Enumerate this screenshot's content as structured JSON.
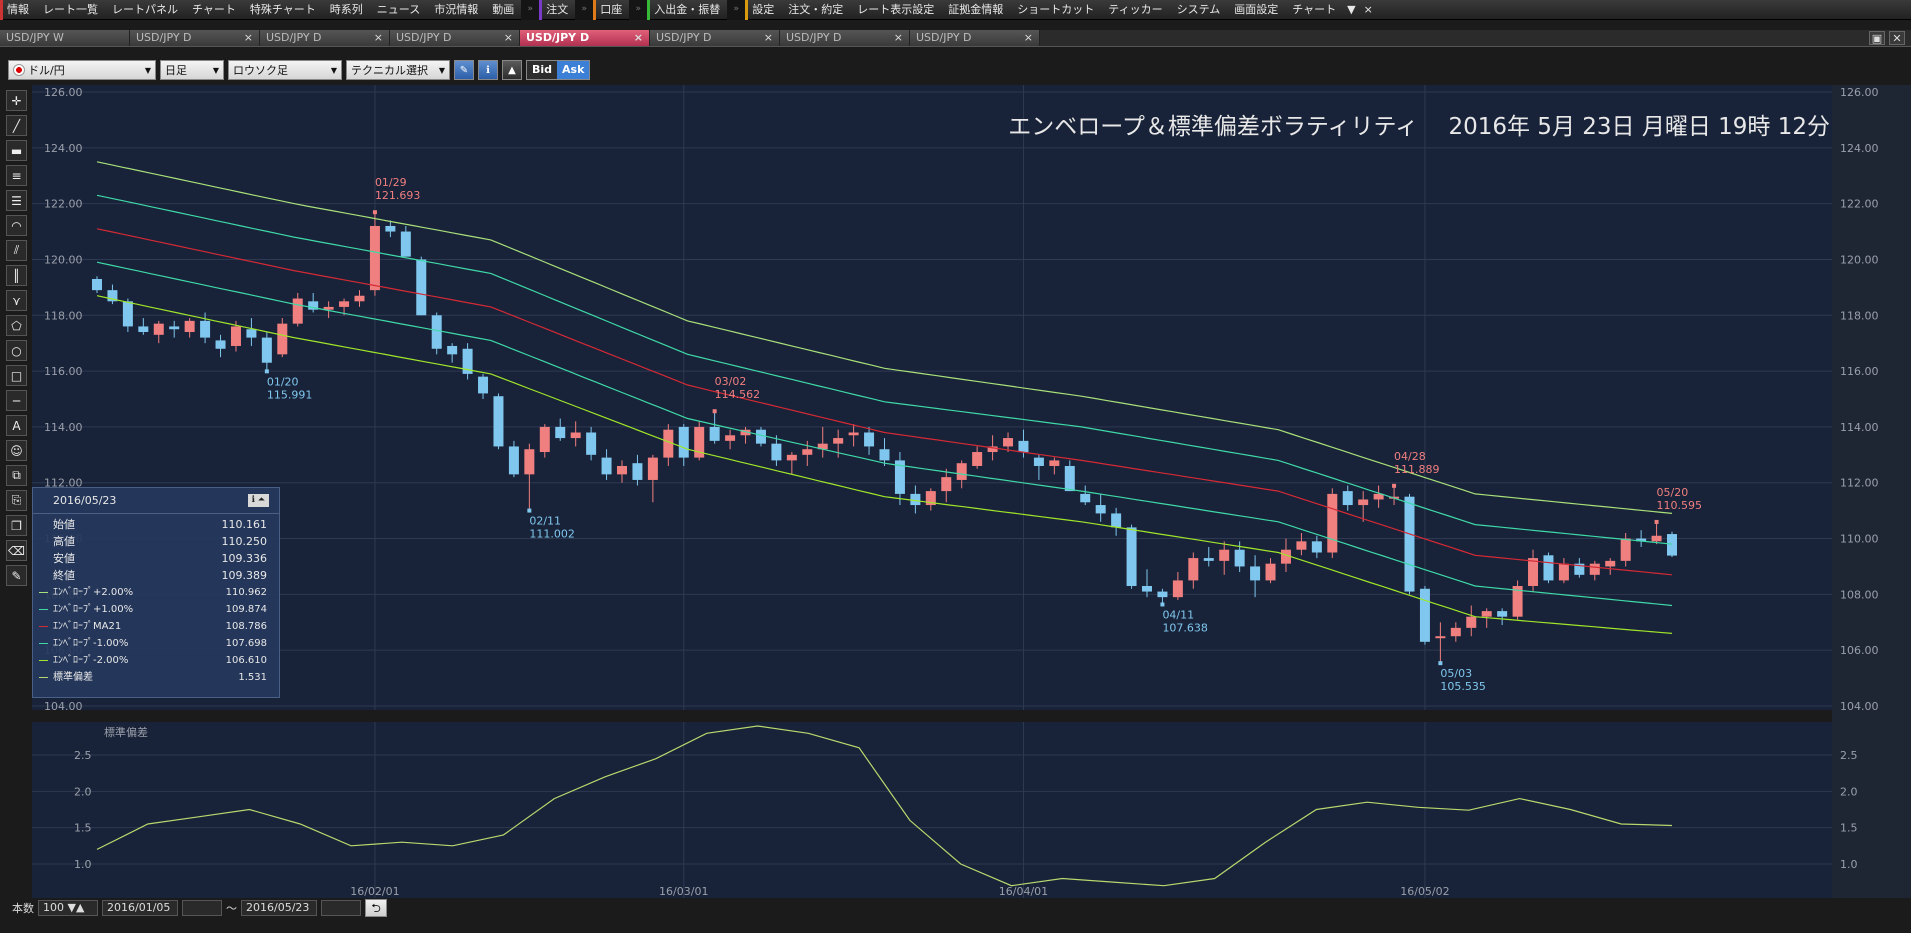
{
  "menu": {
    "items": [
      {
        "label": "情報",
        "mark": "r"
      },
      {
        "label": "レート一覧"
      },
      {
        "label": "レートパネル"
      },
      {
        "label": "チャート"
      },
      {
        "label": "特殊チャート"
      },
      {
        "label": "時系列"
      },
      {
        "label": "ニュース"
      },
      {
        "label": "市況情報"
      },
      {
        "label": "動画"
      },
      {
        "label": "注文",
        "mark": "p"
      },
      {
        "label": "口座",
        "mark": "o"
      },
      {
        "label": "入出金・振替",
        "mark": "g"
      },
      {
        "label": "設定",
        "mark": "y"
      },
      {
        "label": "注文・約定"
      },
      {
        "label": "レート表示設定"
      },
      {
        "label": "証拠金情報"
      },
      {
        "label": "ショートカット"
      },
      {
        "label": "ティッカー"
      },
      {
        "label": "システム"
      },
      {
        "label": "画面設定"
      },
      {
        "label": "チャート"
      }
    ],
    "overflow_glyph": "»",
    "dropdown_glyph": "▼",
    "close_glyph": "×"
  },
  "tabs": [
    {
      "label": "USD/JPY W",
      "active": false
    },
    {
      "label": "USD/JPY D",
      "active": false
    },
    {
      "label": "USD/JPY D",
      "active": false
    },
    {
      "label": "USD/JPY D",
      "active": false
    },
    {
      "label": "USD/JPY D",
      "active": true
    },
    {
      "label": "USD/JPY D",
      "active": false
    },
    {
      "label": "USD/JPY D",
      "active": false
    },
    {
      "label": "USD/JPY D",
      "active": false
    }
  ],
  "tab_close_glyph": "×",
  "window_buttons": [
    "▣",
    "✕"
  ],
  "toolbar": {
    "symbol": "ドル/円",
    "interval": "日足",
    "chart_kind": "ロウソク足",
    "technical": "テクニカル選択",
    "bid": "Bid",
    "ask": "Ask",
    "pen_icon": "pencil-icon",
    "info_icon": "info-icon",
    "area_icon": "area-chart-icon"
  },
  "left_tools": [
    "crosshair-icon",
    "trendline-icon",
    "eraser-icon",
    "hline-icon",
    "channel-icon",
    "fibonacci-arc-icon",
    "fan-icon",
    "vline-icon",
    "pitchfork-icon",
    "pentagon-icon",
    "circle-icon",
    "rectangle-icon",
    "line-icon",
    "text-icon",
    "smiley-icon",
    "copy-icon",
    "paste-icon",
    "duplicate-icon",
    "erase-all-icon",
    "eraser-small-icon"
  ],
  "left_tool_glyphs": [
    "✛",
    "╱",
    "▬",
    "≡",
    "☰",
    "◠",
    "⫽",
    "║",
    "⋎",
    "⬠",
    "○",
    "□",
    "─",
    "A",
    "☺",
    "⧉",
    "⎘",
    "❐",
    "⌫",
    "✎"
  ],
  "chart": {
    "title": "エンベロープ＆標準偏差ボラティリティ　 2016年 5月 23日 月曜日 19時 12分",
    "main_yticks": [
      "126.00",
      "124.00",
      "122.00",
      "120.00",
      "118.00",
      "116.00",
      "114.00",
      "112.00",
      "110.00",
      "108.00",
      "106.00",
      "104.00"
    ],
    "sub_label": "標準偏差",
    "sub_yticks": [
      "2.5",
      "2.0",
      "1.5",
      "1.0"
    ],
    "xticks": [
      "16/02/01",
      "16/03/01",
      "16/04/01",
      "16/05/02"
    ],
    "annotations": [
      {
        "date": "01/29",
        "value": "121.693",
        "kind": "high"
      },
      {
        "date": "01/20",
        "value": "115.991",
        "kind": "low"
      },
      {
        "date": "02/11",
        "value": "111.002",
        "kind": "low"
      },
      {
        "date": "03/02",
        "value": "114.562",
        "kind": "high"
      },
      {
        "date": "04/11",
        "value": "107.638",
        "kind": "low"
      },
      {
        "date": "04/28",
        "value": "111.889",
        "kind": "high"
      },
      {
        "date": "05/03",
        "value": "105.535",
        "kind": "low"
      },
      {
        "date": "05/20",
        "value": "110.595",
        "kind": "high"
      }
    ],
    "colors": {
      "background": "#182238",
      "up": "#f07f7f",
      "down": "#7fc7ee",
      "env2": "#a8e07a",
      "env1": "#3fd9a8",
      "ma": "#d42a35",
      "envm1": "#3fd9a8",
      "envm2": "#9fe62a",
      "stdev": "#b7d96e",
      "grid": "#2e3a52"
    }
  },
  "chart_data": {
    "type": "candlestick",
    "y_range_main": [
      104,
      126
    ],
    "y_range_stdev": [
      0.6,
      2.9
    ],
    "x_range": [
      "2016/01/05",
      "2016/05/23"
    ],
    "candles": [
      [
        119.3,
        119.4,
        118.8,
        118.9
      ],
      [
        118.9,
        119.1,
        118.4,
        118.5
      ],
      [
        118.5,
        118.6,
        117.4,
        117.6
      ],
      [
        117.6,
        117.9,
        117.3,
        117.4
      ],
      [
        117.3,
        117.8,
        117.0,
        117.7
      ],
      [
        117.6,
        117.8,
        117.2,
        117.5
      ],
      [
        117.4,
        117.9,
        117.2,
        117.8
      ],
      [
        117.8,
        118.1,
        117.0,
        117.2
      ],
      [
        117.1,
        117.3,
        116.5,
        116.8
      ],
      [
        116.9,
        117.8,
        116.7,
        117.6
      ],
      [
        117.5,
        117.9,
        116.9,
        117.2
      ],
      [
        117.2,
        117.4,
        115.991,
        116.3
      ],
      [
        116.6,
        117.9,
        116.5,
        117.7
      ],
      [
        117.7,
        118.8,
        117.6,
        118.6
      ],
      [
        118.5,
        118.8,
        118.1,
        118.2
      ],
      [
        118.2,
        118.5,
        117.9,
        118.3
      ],
      [
        118.3,
        118.6,
        118.0,
        118.5
      ],
      [
        118.5,
        118.9,
        118.3,
        118.7
      ],
      [
        118.9,
        121.693,
        118.7,
        121.2
      ],
      [
        121.2,
        121.4,
        120.8,
        121.0
      ],
      [
        121.0,
        121.2,
        120.1,
        120.1
      ],
      [
        120.0,
        120.1,
        118.0,
        118.0
      ],
      [
        118.0,
        118.1,
        116.6,
        116.8
      ],
      [
        116.9,
        117.0,
        116.3,
        116.6
      ],
      [
        116.8,
        117.0,
        115.7,
        115.9
      ],
      [
        115.8,
        115.9,
        115.0,
        115.2
      ],
      [
        115.1,
        115.2,
        113.2,
        113.3
      ],
      [
        113.3,
        113.5,
        112.2,
        112.3
      ],
      [
        112.3,
        113.4,
        111.002,
        113.2
      ],
      [
        113.1,
        114.1,
        112.9,
        114.0
      ],
      [
        114.0,
        114.3,
        113.5,
        113.6
      ],
      [
        113.6,
        114.2,
        113.3,
        113.8
      ],
      [
        113.8,
        114.0,
        112.8,
        113.0
      ],
      [
        112.9,
        113.2,
        112.1,
        112.3
      ],
      [
        112.3,
        112.8,
        112.0,
        112.6
      ],
      [
        112.7,
        113.0,
        111.9,
        112.1
      ],
      [
        112.1,
        113.0,
        111.3,
        112.9
      ],
      [
        112.9,
        114.1,
        112.6,
        113.9
      ],
      [
        114.0,
        114.1,
        112.6,
        112.9
      ],
      [
        112.9,
        114.2,
        112.8,
        114.0
      ],
      [
        114.0,
        114.562,
        113.4,
        113.5
      ],
      [
        113.5,
        113.9,
        113.2,
        113.7
      ],
      [
        113.7,
        114.0,
        113.4,
        113.9
      ],
      [
        113.9,
        114.0,
        113.3,
        113.4
      ],
      [
        113.4,
        113.7,
        112.6,
        112.8
      ],
      [
        112.8,
        113.1,
        112.3,
        113.0
      ],
      [
        113.0,
        113.5,
        112.6,
        113.2
      ],
      [
        113.2,
        114.0,
        112.9,
        113.4
      ],
      [
        113.4,
        113.9,
        112.9,
        113.6
      ],
      [
        113.7,
        114.1,
        113.3,
        113.8
      ],
      [
        113.8,
        114.0,
        113.0,
        113.3
      ],
      [
        113.2,
        113.6,
        112.6,
        112.8
      ],
      [
        112.8,
        113.1,
        111.2,
        111.6
      ],
      [
        111.6,
        111.9,
        110.9,
        111.2
      ],
      [
        111.2,
        111.8,
        111.0,
        111.7
      ],
      [
        111.7,
        112.5,
        111.3,
        112.2
      ],
      [
        112.1,
        112.8,
        111.8,
        112.7
      ],
      [
        112.6,
        113.3,
        112.5,
        113.1
      ],
      [
        113.1,
        113.7,
        112.8,
        113.3
      ],
      [
        113.3,
        113.8,
        113.1,
        113.6
      ],
      [
        113.5,
        113.9,
        112.9,
        113.1
      ],
      [
        112.9,
        113.0,
        112.1,
        112.6
      ],
      [
        112.6,
        112.9,
        112.3,
        112.8
      ],
      [
        112.6,
        112.8,
        111.7,
        111.7
      ],
      [
        111.6,
        111.9,
        111.2,
        111.3
      ],
      [
        111.2,
        111.6,
        110.6,
        110.9
      ],
      [
        110.9,
        111.1,
        110.1,
        110.4
      ],
      [
        110.4,
        110.5,
        108.2,
        108.3
      ],
      [
        108.3,
        108.9,
        107.9,
        108.1
      ],
      [
        108.1,
        108.2,
        107.638,
        107.9
      ],
      [
        107.9,
        108.8,
        107.8,
        108.5
      ],
      [
        108.5,
        109.5,
        108.2,
        109.3
      ],
      [
        109.3,
        109.7,
        109.0,
        109.2
      ],
      [
        109.2,
        109.9,
        108.7,
        109.6
      ],
      [
        109.6,
        109.9,
        108.8,
        109.0
      ],
      [
        109.0,
        109.4,
        107.9,
        108.5
      ],
      [
        108.5,
        109.3,
        108.4,
        109.1
      ],
      [
        109.1,
        110.0,
        108.8,
        109.6
      ],
      [
        109.6,
        110.2,
        109.4,
        109.9
      ],
      [
        109.9,
        110.1,
        109.3,
        109.5
      ],
      [
        109.5,
        111.8,
        109.3,
        111.6
      ],
      [
        111.7,
        111.9,
        111.0,
        111.2
      ],
      [
        111.2,
        111.7,
        110.6,
        111.4
      ],
      [
        111.4,
        111.9,
        111.1,
        111.6
      ],
      [
        111.5,
        111.889,
        111.2,
        111.5
      ],
      [
        111.5,
        111.6,
        108.0,
        108.1
      ],
      [
        108.2,
        108.3,
        106.2,
        106.3
      ],
      [
        106.5,
        107.0,
        105.535,
        106.5
      ],
      [
        106.5,
        107.0,
        106.3,
        106.8
      ],
      [
        106.8,
        107.6,
        106.5,
        107.2
      ],
      [
        107.2,
        107.5,
        106.8,
        107.4
      ],
      [
        107.4,
        107.5,
        106.9,
        107.2
      ],
      [
        107.2,
        108.5,
        107.1,
        108.3
      ],
      [
        108.3,
        109.6,
        108.1,
        109.3
      ],
      [
        109.4,
        109.5,
        108.4,
        108.5
      ],
      [
        108.5,
        109.3,
        108.4,
        109.1
      ],
      [
        109.1,
        109.3,
        108.6,
        108.7
      ],
      [
        108.7,
        109.2,
        108.5,
        109.1
      ],
      [
        109.0,
        109.3,
        108.7,
        109.2
      ],
      [
        109.2,
        110.2,
        109.0,
        110.0
      ],
      [
        110.0,
        110.3,
        109.7,
        109.9
      ],
      [
        109.9,
        110.595,
        109.8,
        110.1
      ],
      [
        110.161,
        110.25,
        109.336,
        109.389
      ]
    ],
    "series": [
      {
        "name": "エンベロープ+2.00%",
        "color": "#a8e07a",
        "values": [
          123.5,
          122.0,
          120.7,
          117.8,
          116.1,
          115.1,
          113.9,
          111.6,
          110.9
        ]
      },
      {
        "name": "エンベロープ+1.00%",
        "color": "#3fd9a8",
        "values": [
          122.3,
          120.8,
          119.5,
          116.6,
          114.9,
          114.0,
          112.8,
          110.5,
          109.8
        ]
      },
      {
        "name": "エンベロープMA21",
        "color": "#d42a35",
        "values": [
          121.1,
          119.6,
          118.3,
          115.5,
          113.8,
          112.8,
          111.7,
          109.4,
          108.7
        ]
      },
      {
        "name": "エンベロープ-1.00%",
        "color": "#3fd9a8",
        "values": [
          119.9,
          118.4,
          117.1,
          114.3,
          112.7,
          111.7,
          110.6,
          108.3,
          107.6
        ]
      },
      {
        "name": "エンベロープ-2.00%",
        "color": "#9fe62a",
        "values": [
          118.7,
          117.2,
          115.9,
          113.2,
          111.5,
          110.6,
          109.5,
          107.2,
          106.6
        ]
      }
    ],
    "stdev": [
      1.2,
      1.55,
      1.65,
      1.75,
      1.55,
      1.25,
      1.3,
      1.25,
      1.4,
      1.9,
      2.2,
      2.45,
      2.8,
      2.9,
      2.8,
      2.6,
      1.6,
      1.0,
      0.7,
      0.8,
      0.75,
      0.7,
      0.8,
      1.3,
      1.75,
      1.85,
      1.78,
      1.74,
      1.9,
      1.75,
      1.55,
      1.53
    ]
  },
  "info_panel": {
    "date": "2016/05/23",
    "icon_glyph": "ℹ ⏶",
    "ohlc": [
      {
        "label": "始値",
        "value": "110.161"
      },
      {
        "label": "高値",
        "value": "110.250"
      },
      {
        "label": "安値",
        "value": "109.336"
      },
      {
        "label": "終値",
        "value": "109.389"
      }
    ],
    "indicators": [
      {
        "label": "ｴﾝﾍﾞﾛｰﾌﾟ+2.00%",
        "value": "110.962",
        "color": "#a8e07a"
      },
      {
        "label": "ｴﾝﾍﾞﾛｰﾌﾟ+1.00%",
        "value": "109.874",
        "color": "#3fd9a8"
      },
      {
        "label": "ｴﾝﾍﾞﾛｰﾌﾟMA21",
        "value": "108.786",
        "color": "#d42a35"
      },
      {
        "label": "ｴﾝﾍﾞﾛｰﾌﾟ-1.00%",
        "value": "107.698",
        "color": "#3fd9a8"
      },
      {
        "label": "ｴﾝﾍﾞﾛｰﾌﾟ-2.00%",
        "value": "106.610",
        "color": "#9fe62a"
      },
      {
        "label": "標準偏差",
        "value": "1.531",
        "color": "#b7d96e"
      }
    ]
  },
  "bottom": {
    "count_label": "本数",
    "count_value": "100",
    "start_date": "2016/01/05",
    "tilde": "～",
    "end_date": "2016/05/23",
    "back_glyph": "⮌"
  }
}
